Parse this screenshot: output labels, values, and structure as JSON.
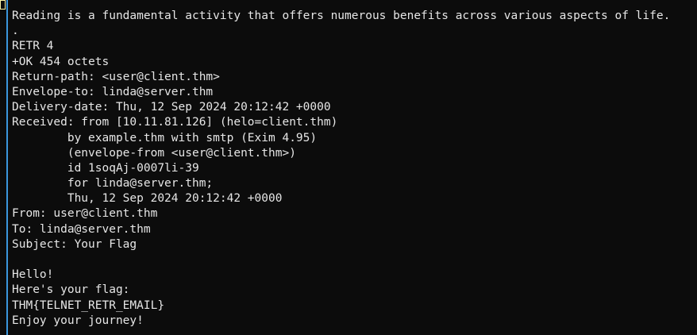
{
  "terminal": {
    "lines": [
      "Reading is a fundamental activity that offers numerous benefits across various aspects of life.",
      ".",
      "RETR 4",
      "+OK 454 octets",
      "Return-path: <user@client.thm>",
      "Envelope-to: linda@server.thm",
      "Delivery-date: Thu, 12 Sep 2024 20:12:42 +0000",
      "Received: from [10.11.81.126] (helo=client.thm)",
      "        by example.thm with smtp (Exim 4.95)",
      "        (envelope-from <user@client.thm>)",
      "        id 1soqAj-0007li-39",
      "        for linda@server.thm;",
      "        Thu, 12 Sep 2024 20:12:42 +0000",
      "From: user@client.thm",
      "To: linda@server.thm",
      "Subject: Your Flag",
      "",
      "Hello!",
      "Here's your flag:",
      "THM{TELNET_RETR_EMAIL}",
      "Enjoy your journey!"
    ]
  },
  "colors": {
    "background": "#0c0c0c",
    "foreground": "#e6e6e6",
    "border": "#3a96dd",
    "cursor": "#f9f1a5"
  }
}
